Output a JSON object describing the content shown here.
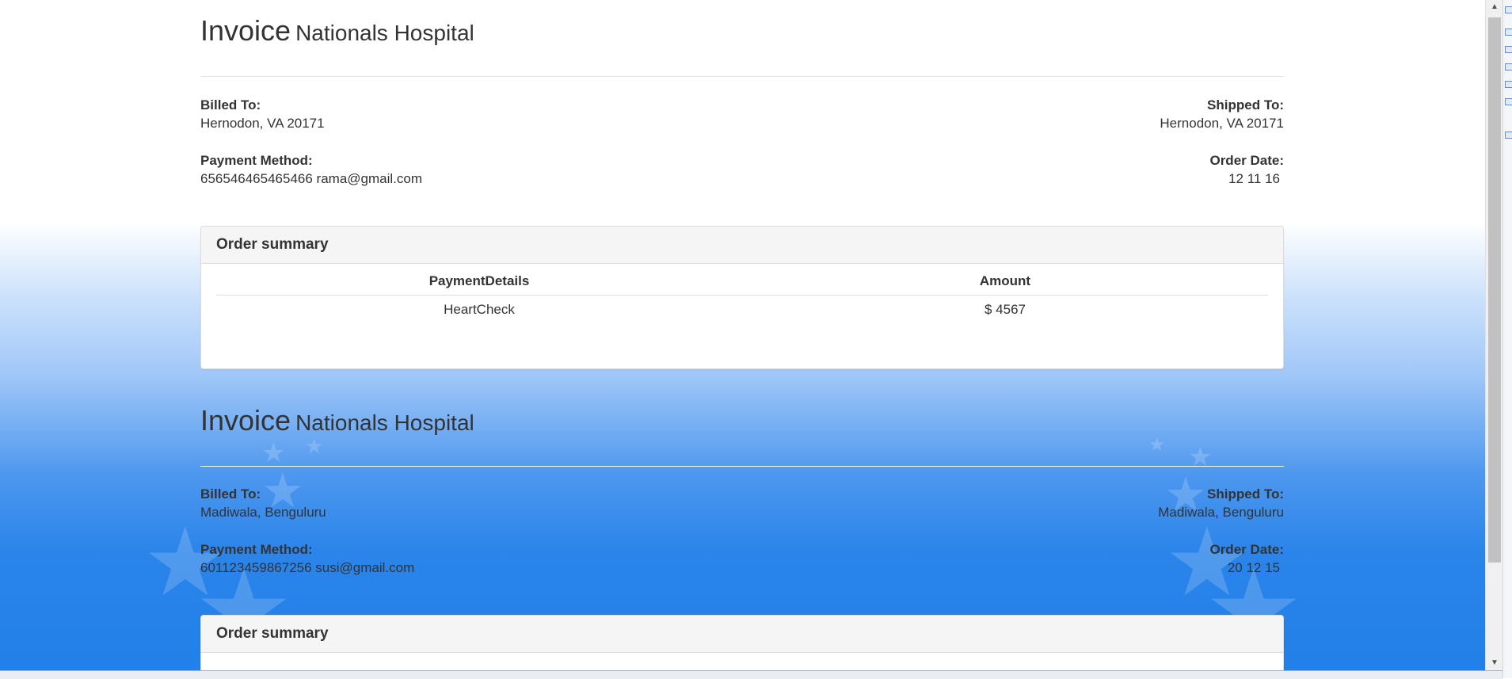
{
  "invoices": [
    {
      "invoice_label": "Invoice",
      "hospital": "Nationals Hospital",
      "billed_to_label": "Billed To:",
      "billed_to": "Hernodon, VA 20171",
      "shipped_to_label": "Shipped To:",
      "shipped_to": "Hernodon, VA 20171",
      "payment_method_label": "Payment Method:",
      "payment_method": "656546465465466 rama@gmail.com",
      "order_date_label": "Order Date:",
      "order_date": "12 11 16",
      "summary_title": "Order summary",
      "columns": [
        "PaymentDetails",
        "Amount"
      ],
      "rows": [
        [
          "HeartCheck",
          "$ 4567"
        ]
      ]
    },
    {
      "invoice_label": "Invoice",
      "hospital": "Nationals Hospital",
      "billed_to_label": "Billed To:",
      "billed_to": "Madiwala, Benguluru",
      "shipped_to_label": "Shipped To:",
      "shipped_to": "Madiwala, Benguluru",
      "payment_method_label": "Payment Method:",
      "payment_method": "601123459867256 susi@gmail.com",
      "order_date_label": "Order Date:",
      "order_date": "20 12 15",
      "summary_title": "Order summary"
    }
  ],
  "scrollbar": {
    "up_arrow": "▲",
    "down_arrow": "▼"
  },
  "colors": {
    "background_top": "#ffffff",
    "background_bottom": "#2280e8",
    "panel_heading": "#f5f5f5",
    "text": "#333333"
  }
}
